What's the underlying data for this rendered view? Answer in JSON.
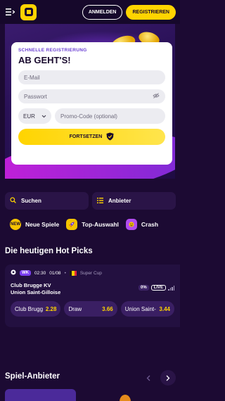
{
  "header": {
    "login_label": "ANMELDEN",
    "register_label": "REGISTRIEREN"
  },
  "registration": {
    "subtitle": "SCHNELLE REGISTRIERUNG",
    "title": "AB GEHT'S!",
    "email_placeholder": "E-Mail",
    "password_placeholder": "Passwort",
    "currency": "EUR",
    "promo_placeholder": "Promo-Code (optional)",
    "submit_label": "FORTSETZEN"
  },
  "quick": {
    "search_label": "Suchen",
    "providers_label": "Anbieter"
  },
  "categories": [
    {
      "label": "Neue Spiele",
      "icon": "new-badge-icon",
      "color": "#f5c400"
    },
    {
      "label": "Top-Auswahl",
      "icon": "rocket-icon",
      "color": "#f5c400"
    },
    {
      "label": "Crash",
      "icon": "crash-icon",
      "color": "#b04bf0"
    }
  ],
  "hot_picks": {
    "title": "Die heutigen Hot Picks",
    "match": {
      "tag": "WK",
      "time": "02:30",
      "date": "01/08",
      "competition": "Super Cup",
      "home": "Club Brugge KV",
      "away": "Union Saint-Gilloise",
      "percent": "0%",
      "live": "LIVE",
      "odds": [
        {
          "label": "Club Brugge",
          "value": "2.28"
        },
        {
          "label": "Draw",
          "value": "3.66"
        },
        {
          "label": "Union Saint-Gilloise",
          "value": "3.44"
        }
      ]
    }
  },
  "providers": {
    "title": "Spiel-Anbieter"
  },
  "colors": {
    "accent": "#ffd400",
    "background": "#1c0a33",
    "card": "#231040"
  }
}
